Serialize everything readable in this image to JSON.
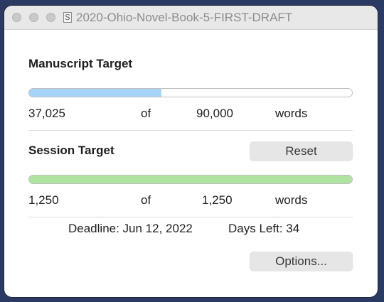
{
  "window": {
    "title": "2020-Ohio-Novel-Book-5-FIRST-DRAFT",
    "doc_icon_glyph": "S"
  },
  "manuscript": {
    "heading": "Manuscript Target",
    "current": "37,025",
    "of_label": "of",
    "target": "90,000",
    "unit": "words",
    "progress_fraction": 0.41,
    "fill_color": "#a6d4f7"
  },
  "session": {
    "heading": "Session Target",
    "reset_label": "Reset",
    "current": "1,250",
    "of_label": "of",
    "target": "1,250",
    "unit": "words",
    "progress_fraction": 1.0,
    "fill_color": "#aee3a0"
  },
  "footer": {
    "deadline_text": "Deadline: Jun 12, 2022",
    "days_left_text": "Days Left: 34",
    "options_label": "Options..."
  }
}
